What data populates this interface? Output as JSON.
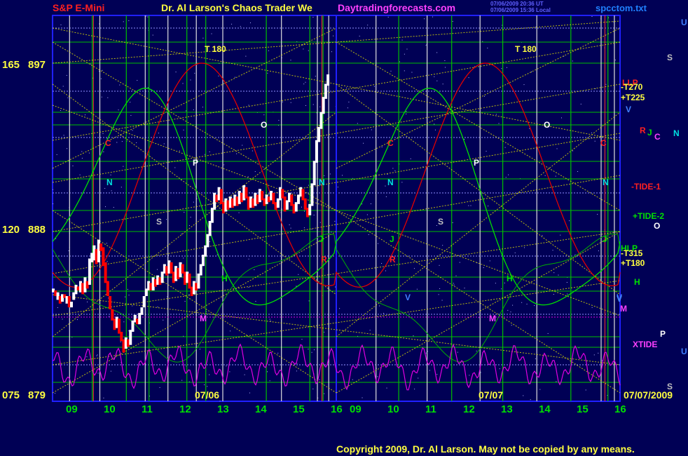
{
  "header": {
    "instrument": "S&P E-Mini",
    "title": "Dr. Al Larson's Chaos Trader We",
    "site": "Daytradingforecasts.com",
    "timestamp_1": "07/06/2009 20:36 UT",
    "timestamp_2": "07/06/2009 15:36 Local",
    "filename": "spcctom.txt"
  },
  "footer": {
    "copyright": "Copyright 2009, Dr. Al Larson. May not be copied by any means."
  },
  "colors": {
    "background": "#000055",
    "axis": "#2020ff",
    "grid_green": "#00c000",
    "yellow_lines": "#e8e800",
    "red_line": "#e00000",
    "green_line": "#00e000",
    "magenta_line": "#e000e0",
    "price_up": "#ffffff",
    "price_down": "#ff0000"
  },
  "chart_data": {
    "type": "line",
    "y_labels_left": [
      {
        "a": "165",
        "b": "897",
        "price": 897
      },
      {
        "a": "120",
        "b": "888",
        "price": 888
      },
      {
        "a": "075",
        "b": "879",
        "price": 879
      }
    ],
    "ylim": [
      879,
      897
    ],
    "xlim": [
      8.5,
      16.0,
      8.5,
      16.0
    ],
    "x_ticks_day1": [
      "09",
      "10",
      "11",
      "12",
      "13",
      "14",
      "15",
      "16"
    ],
    "x_ticks_day2": [
      "09",
      "10",
      "11",
      "12",
      "13",
      "14",
      "15",
      "16"
    ],
    "date_labels": {
      "day1": "07/06",
      "day2": "07/07",
      "end": "07/07/2009"
    },
    "t180_labels": [
      "T 180",
      "T 180"
    ],
    "right_labels": [
      {
        "text": "U",
        "color": "#4080ff"
      },
      {
        "text": "S",
        "color": "#c0c0c0"
      },
      {
        "text": "LLP",
        "color": "#ff2020"
      },
      {
        "text": "-T270",
        "color": "#ffff40"
      },
      {
        "text": "+T225",
        "color": "#ffff40"
      },
      {
        "text": "V",
        "color": "#4080ff"
      },
      {
        "text": "R",
        "color": "#ff2020"
      },
      {
        "text": "J",
        "color": "#00e000"
      },
      {
        "text": "C",
        "color": "#ff40ff"
      },
      {
        "text": "N",
        "color": "#00e0e0"
      },
      {
        "text": "-TIDE-1",
        "color": "#ff2020"
      },
      {
        "text": "+TIDE-2",
        "color": "#00e000"
      },
      {
        "text": "O",
        "color": "#ffffff"
      },
      {
        "text": "HLP",
        "color": "#00e000"
      },
      {
        "text": "-T315",
        "color": "#ffff40"
      },
      {
        "text": "+T180",
        "color": "#ffff40"
      },
      {
        "text": "H",
        "color": "#00e000"
      },
      {
        "text": "V",
        "color": "#4080ff"
      },
      {
        "text": "M",
        "color": "#ff40ff"
      },
      {
        "text": "P",
        "color": "#ffffff"
      },
      {
        "text": "XTIDE",
        "color": "#ff40ff"
      },
      {
        "text": "U",
        "color": "#4080ff"
      },
      {
        "text": "S",
        "color": "#c0c0c0"
      }
    ],
    "chart_letters": [
      {
        "t": "P",
        "c": "#ffffff"
      },
      {
        "t": "N",
        "c": "#00e0e0"
      },
      {
        "t": "S",
        "c": "#c0c0c0"
      },
      {
        "t": "O",
        "c": "#ffffff"
      },
      {
        "t": "C",
        "c": "#ff2020"
      },
      {
        "t": "N",
        "c": "#00e0e0"
      },
      {
        "t": "J",
        "c": "#00e000"
      },
      {
        "t": "R",
        "c": "#ff2020"
      },
      {
        "t": "H",
        "c": "#00e000"
      },
      {
        "t": "M",
        "c": "#ff40ff"
      },
      {
        "t": "V",
        "c": "#4080ff"
      },
      {
        "t": "C",
        "c": "#ff2020"
      },
      {
        "t": "N",
        "c": "#00e0e0"
      },
      {
        "t": "J",
        "c": "#00e000"
      },
      {
        "t": "R",
        "c": "#ff2020"
      },
      {
        "t": "V",
        "c": "#4080ff"
      },
      {
        "t": "S",
        "c": "#c0c0c0"
      },
      {
        "t": "P",
        "c": "#ffffff"
      },
      {
        "t": "M",
        "c": "#ff40ff"
      },
      {
        "t": "H",
        "c": "#00e000"
      },
      {
        "t": "O",
        "c": "#ffffff"
      },
      {
        "t": "C",
        "c": "#ff2020"
      },
      {
        "t": "N",
        "c": "#00e0e0"
      },
      {
        "t": "J",
        "c": "#00e000"
      }
    ],
    "price_bars": [
      [
        8.52,
        884.8,
        885.0
      ],
      [
        8.58,
        884.9,
        884.6
      ],
      [
        8.64,
        884.4,
        884.8
      ],
      [
        8.7,
        884.6,
        884.2
      ],
      [
        8.76,
        884.3,
        884.7
      ],
      [
        8.82,
        884.7,
        884.5
      ],
      [
        8.88,
        884.2,
        884.6
      ],
      [
        8.94,
        884.6,
        884.0
      ],
      [
        9.0,
        884.0,
        884.3
      ],
      [
        9.06,
        884.4,
        884.8
      ],
      [
        9.12,
        884.7,
        885.2
      ],
      [
        9.18,
        885.1,
        884.9
      ],
      [
        9.24,
        884.8,
        885.4
      ],
      [
        9.3,
        885.3,
        884.7
      ],
      [
        9.36,
        884.8,
        885.6
      ],
      [
        9.42,
        885.4,
        885.0
      ],
      [
        9.48,
        885.2,
        886.6
      ],
      [
        9.54,
        886.4,
        886.9
      ],
      [
        9.6,
        886.5,
        887.3
      ],
      [
        9.66,
        887.1,
        886.3
      ],
      [
        9.72,
        886.4,
        887.6
      ],
      [
        9.78,
        887.4,
        887.0
      ],
      [
        9.84,
        887.2,
        886.2
      ],
      [
        9.9,
        886.4,
        885.3
      ],
      [
        9.96,
        885.4,
        884.6
      ],
      [
        10.02,
        884.6,
        883.9
      ],
      [
        10.08,
        883.9,
        883.3
      ],
      [
        10.14,
        883.4,
        882.8
      ],
      [
        10.2,
        882.9,
        883.5
      ],
      [
        10.26,
        883.4,
        882.6
      ],
      [
        10.32,
        882.7,
        882.2
      ],
      [
        10.38,
        882.3,
        881.6
      ],
      [
        10.44,
        881.8,
        882.4
      ],
      [
        10.5,
        882.3,
        881.9
      ],
      [
        10.56,
        882.0,
        882.8
      ],
      [
        10.62,
        882.7,
        883.3
      ],
      [
        10.68,
        883.2,
        883.6
      ],
      [
        10.74,
        883.4,
        883.1
      ],
      [
        10.8,
        883.1,
        883.7
      ],
      [
        10.86,
        883.6,
        884.0
      ],
      [
        10.92,
        884.0,
        884.6
      ],
      [
        10.98,
        884.6,
        885.0
      ],
      [
        11.04,
        884.9,
        885.4
      ],
      [
        11.1,
        885.3,
        884.9
      ],
      [
        11.16,
        884.9,
        885.6
      ],
      [
        11.22,
        885.5,
        885.1
      ],
      [
        11.28,
        885.2,
        885.7
      ],
      [
        11.34,
        885.6,
        885.2
      ],
      [
        11.4,
        885.3,
        885.9
      ],
      [
        11.46,
        885.8,
        886.3
      ],
      [
        11.52,
        886.2,
        885.7
      ],
      [
        11.58,
        885.8,
        886.5
      ],
      [
        11.64,
        886.4,
        885.8
      ],
      [
        11.7,
        885.9,
        885.3
      ],
      [
        11.76,
        885.4,
        886.2
      ],
      [
        11.82,
        886.1,
        885.5
      ],
      [
        11.88,
        885.6,
        886.4
      ],
      [
        11.94,
        886.3,
        885.8
      ],
      [
        12.0,
        885.9,
        885.2
      ],
      [
        12.06,
        885.3,
        885.9
      ],
      [
        12.12,
        885.8,
        885.0
      ],
      [
        12.18,
        885.1,
        884.6
      ],
      [
        12.24,
        884.7,
        885.4
      ],
      [
        12.3,
        885.3,
        884.9
      ],
      [
        12.36,
        885.0,
        885.8
      ],
      [
        12.42,
        885.7,
        886.3
      ],
      [
        12.48,
        886.2,
        886.8
      ],
      [
        12.54,
        886.7,
        887.3
      ],
      [
        12.6,
        887.2,
        887.9
      ],
      [
        12.66,
        887.8,
        888.6
      ],
      [
        12.72,
        888.5,
        889.3
      ],
      [
        12.78,
        889.2,
        890.1
      ],
      [
        12.84,
        890.0,
        889.6
      ],
      [
        12.9,
        889.7,
        890.4
      ],
      [
        12.96,
        890.3,
        889.5
      ],
      [
        13.02,
        889.6,
        889.0
      ],
      [
        13.08,
        889.1,
        889.8
      ],
      [
        13.14,
        889.7,
        889.2
      ],
      [
        13.2,
        889.3,
        889.9
      ],
      [
        13.26,
        889.8,
        889.3
      ],
      [
        13.32,
        889.4,
        890.0
      ],
      [
        13.38,
        889.9,
        889.4
      ],
      [
        13.44,
        889.5,
        890.2
      ],
      [
        13.5,
        890.1,
        889.6
      ],
      [
        13.56,
        889.7,
        890.5
      ],
      [
        13.62,
        890.4,
        889.8
      ],
      [
        13.68,
        889.9,
        889.2
      ],
      [
        13.74,
        889.3,
        889.9
      ],
      [
        13.8,
        889.8,
        889.3
      ],
      [
        13.86,
        889.4,
        890.1
      ],
      [
        13.92,
        890.0,
        889.5
      ],
      [
        13.98,
        889.6,
        890.3
      ],
      [
        14.04,
        890.2,
        889.7
      ],
      [
        14.1,
        889.8,
        889.4
      ],
      [
        14.16,
        889.5,
        890.0
      ],
      [
        14.22,
        889.9,
        889.6
      ],
      [
        14.28,
        889.7,
        890.2
      ],
      [
        14.34,
        890.1,
        889.5
      ],
      [
        14.4,
        889.6,
        889.2
      ],
      [
        14.46,
        889.3,
        889.8
      ],
      [
        14.52,
        889.7,
        890.4
      ],
      [
        14.58,
        890.3,
        889.8
      ],
      [
        14.64,
        889.9,
        889.1
      ],
      [
        14.7,
        889.2,
        889.7
      ],
      [
        14.76,
        889.6,
        890.1
      ],
      [
        14.82,
        890.0,
        889.4
      ],
      [
        14.88,
        889.5,
        889.0
      ],
      [
        14.94,
        889.1,
        889.6
      ],
      [
        15.0,
        889.5,
        890.0
      ],
      [
        15.06,
        889.9,
        890.4
      ],
      [
        15.12,
        890.3,
        889.7
      ],
      [
        15.18,
        889.8,
        889.2
      ],
      [
        15.24,
        889.3,
        888.8
      ],
      [
        15.3,
        888.9,
        889.5
      ],
      [
        15.36,
        889.4,
        890.6
      ],
      [
        15.42,
        890.5,
        891.8
      ],
      [
        15.48,
        891.7,
        892.9
      ],
      [
        15.54,
        892.8,
        893.6
      ],
      [
        15.6,
        893.5,
        894.4
      ],
      [
        15.66,
        894.3,
        895.2
      ],
      [
        15.72,
        895.1,
        895.9
      ],
      [
        15.78,
        895.8,
        896.4
      ]
    ]
  }
}
